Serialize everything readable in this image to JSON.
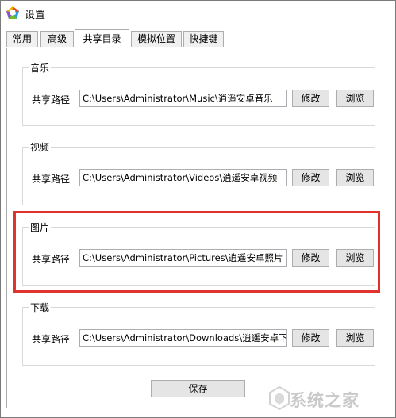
{
  "window": {
    "title": "设置"
  },
  "tabs": [
    {
      "label": "常用"
    },
    {
      "label": "高级"
    },
    {
      "label": "共享目录",
      "active": true
    },
    {
      "label": "模拟位置"
    },
    {
      "label": "快捷键"
    }
  ],
  "groups": {
    "music": {
      "title": "音乐",
      "label": "共享路径",
      "path": "C:\\Users\\Administrator\\Music\\逍遥安卓音乐",
      "modify": "修改",
      "browse": "浏览"
    },
    "videos": {
      "title": "视频",
      "label": "共享路径",
      "path": "C:\\Users\\Administrator\\Videos\\逍遥安卓视频",
      "modify": "修改",
      "browse": "浏览"
    },
    "pictures": {
      "title": "图片",
      "label": "共享路径",
      "path": "C:\\Users\\Administrator\\Pictures\\逍遥安卓照片",
      "modify": "修改",
      "browse": "浏览"
    },
    "downloads": {
      "title": "下载",
      "label": "共享路径",
      "path": "C:\\Users\\Administrator\\Downloads\\逍遥安卓下载",
      "modify": "修改",
      "browse": "浏览"
    }
  },
  "footer": {
    "save_label": "保存"
  },
  "watermark": {
    "text": "系统之家"
  },
  "colors": {
    "highlight": "#e0332e",
    "button_bg": "#e5e5e5",
    "border": "#adadad"
  }
}
